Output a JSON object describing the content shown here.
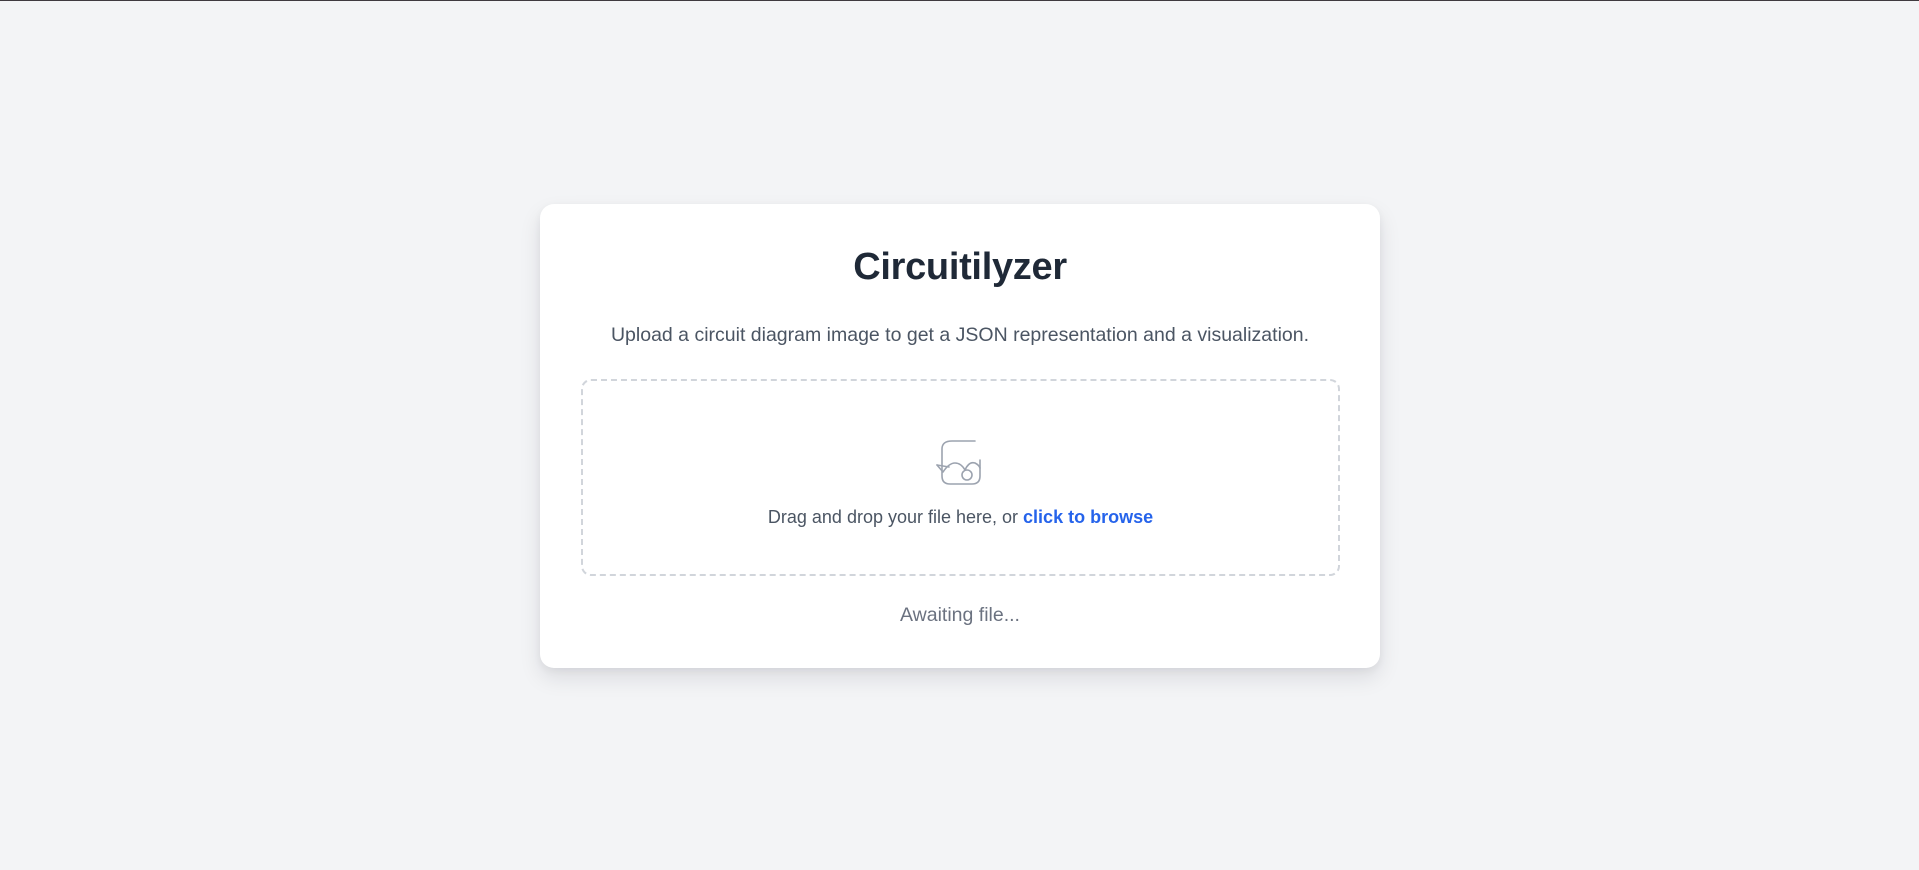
{
  "app": {
    "title": "Circuitilyzer",
    "subtitle": "Upload a circuit diagram image to get a JSON representation and a visualization."
  },
  "dropzone": {
    "icon": "image-upload-icon",
    "prompt_text": "Drag and drop your file here, or",
    "browse_link": "click to browse"
  },
  "status": {
    "text": "Awaiting file..."
  },
  "colors": {
    "background": "#f3f4f6",
    "card": "#ffffff",
    "title": "#1f2937",
    "body_text": "#4b5563",
    "muted_text": "#6b7280",
    "link": "#2563eb",
    "dashed_border": "#d1d5db"
  }
}
